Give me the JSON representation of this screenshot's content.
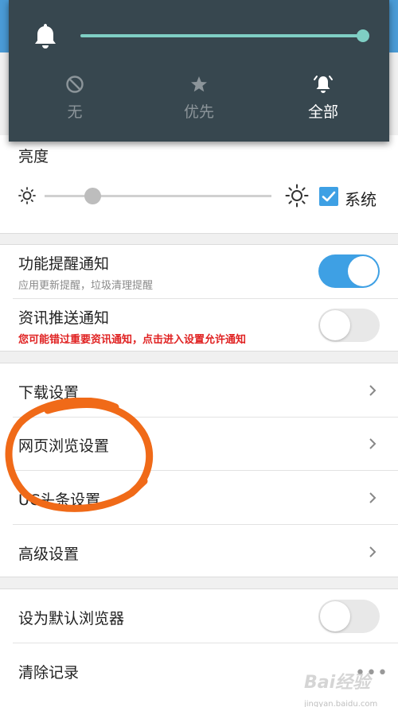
{
  "volume_panel": {
    "level_fraction": 1.0,
    "modes": [
      {
        "label": "无",
        "icon": "no-interrupt-icon",
        "selected": false
      },
      {
        "label": "优先",
        "icon": "star-icon",
        "selected": false
      },
      {
        "label": "全部",
        "icon": "alarm-bell-icon",
        "selected": true
      }
    ],
    "accent_color": "#7fcfc4",
    "background_color": "#37474f"
  },
  "brightness": {
    "title": "亮度",
    "level_fraction": 0.21,
    "system_checked": true,
    "system_label": "系统"
  },
  "notifications": [
    {
      "title": "功能提醒通知",
      "subtitle": "应用更新提醒，垃圾清理提醒",
      "enabled": true
    },
    {
      "title": "资讯推送通知",
      "subtitle": "您可能错过重要资讯通知，点击进入设置允许通知",
      "enabled": false
    }
  ],
  "settings_links": [
    {
      "label": "下载设置"
    },
    {
      "label": "网页浏览设置"
    },
    {
      "label": "UC头条设置"
    },
    {
      "label": "高级设置"
    }
  ],
  "misc": {
    "default_browser_label": "设为默认浏览器",
    "default_browser_enabled": false,
    "clear_records_label": "清除记录",
    "more_icon": "more-dots-icon"
  },
  "watermark": {
    "logo_text": "Bai经验",
    "sub_text": "jingyan.baidu.com"
  },
  "colors": {
    "accent_blue": "#3ea0e4",
    "warning_red": "#e02222",
    "annotation_orange": "#f06a18"
  }
}
